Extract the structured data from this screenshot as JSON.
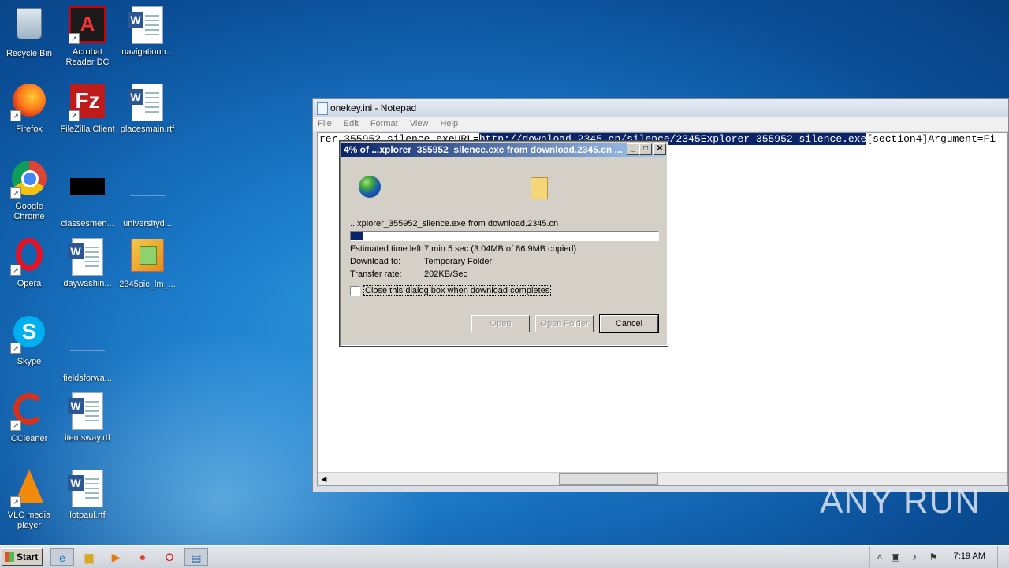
{
  "desktop": {
    "icons": [
      {
        "label": "Recycle Bin",
        "icon": "recycle-bin-icon"
      },
      {
        "label": "Acrobat Reader DC",
        "icon": "acrobat-icon"
      },
      {
        "label": "navigationh...",
        "icon": "word-doc-icon"
      },
      {
        "label": "Firefox",
        "icon": "firefox-icon"
      },
      {
        "label": "FileZilla Client",
        "icon": "filezilla-icon"
      },
      {
        "label": "placesmain.rtf",
        "icon": "word-doc-icon"
      },
      {
        "label": "Google Chrome",
        "icon": "chrome-icon"
      },
      {
        "label": "classesmen...",
        "icon": "black-file-icon"
      },
      {
        "label": "universityd...",
        "icon": "blank-file-icon"
      },
      {
        "label": "Opera",
        "icon": "opera-icon"
      },
      {
        "label": "daywashin...",
        "icon": "word-doc-icon"
      },
      {
        "label": "2345pic_lm_...",
        "icon": "installer-icon"
      },
      {
        "label": "Skype",
        "icon": "skype-icon"
      },
      {
        "label": "fieldsforwa...",
        "icon": "blank-file-icon"
      },
      {
        "label": "CCleaner",
        "icon": "ccleaner-icon"
      },
      {
        "label": "itemsway.rtf",
        "icon": "word-doc-icon"
      },
      {
        "label": "VLC media player",
        "icon": "vlc-icon"
      },
      {
        "label": "lotpaul.rtf",
        "icon": "word-doc-icon"
      }
    ]
  },
  "notepad": {
    "title": "onekey.ini - Notepad",
    "menu": [
      "File",
      "Edit",
      "Format",
      "View",
      "Help"
    ],
    "text_before": "rer_355952_silence.exeURL=",
    "text_selected": "http://download.2345.cn/silence/2345Explorer_355952_silence.exe",
    "text_after": "[section4]Argument=Fi"
  },
  "dialog": {
    "title": "4% of ...xplorer_355952_silence.exe from download.2345.cn ...",
    "file_line": "...xplorer_355952_silence.exe from download.2345.cn",
    "progress_fraction": 0.04,
    "rows": [
      {
        "label": "Estimated time left:",
        "value": "7 min 5 sec (3.04MB of 86.9MB copied)"
      },
      {
        "label": "Download to:",
        "value": "Temporary Folder"
      },
      {
        "label": "Transfer rate:",
        "value": "202KB/Sec"
      }
    ],
    "checkbox_label": "Close this dialog box when download completes",
    "checkbox_checked": false,
    "buttons": {
      "open": "Open",
      "open_folder": "Open Folder",
      "cancel": "Cancel"
    }
  },
  "taskbar": {
    "start_label": "Start",
    "items": [
      "ie-icon",
      "explorer-icon",
      "media-player-icon",
      "chrome-icon",
      "opera-icon",
      "notepad-icon"
    ],
    "clock": "7:19 AM"
  },
  "watermark": "ANY RUN"
}
